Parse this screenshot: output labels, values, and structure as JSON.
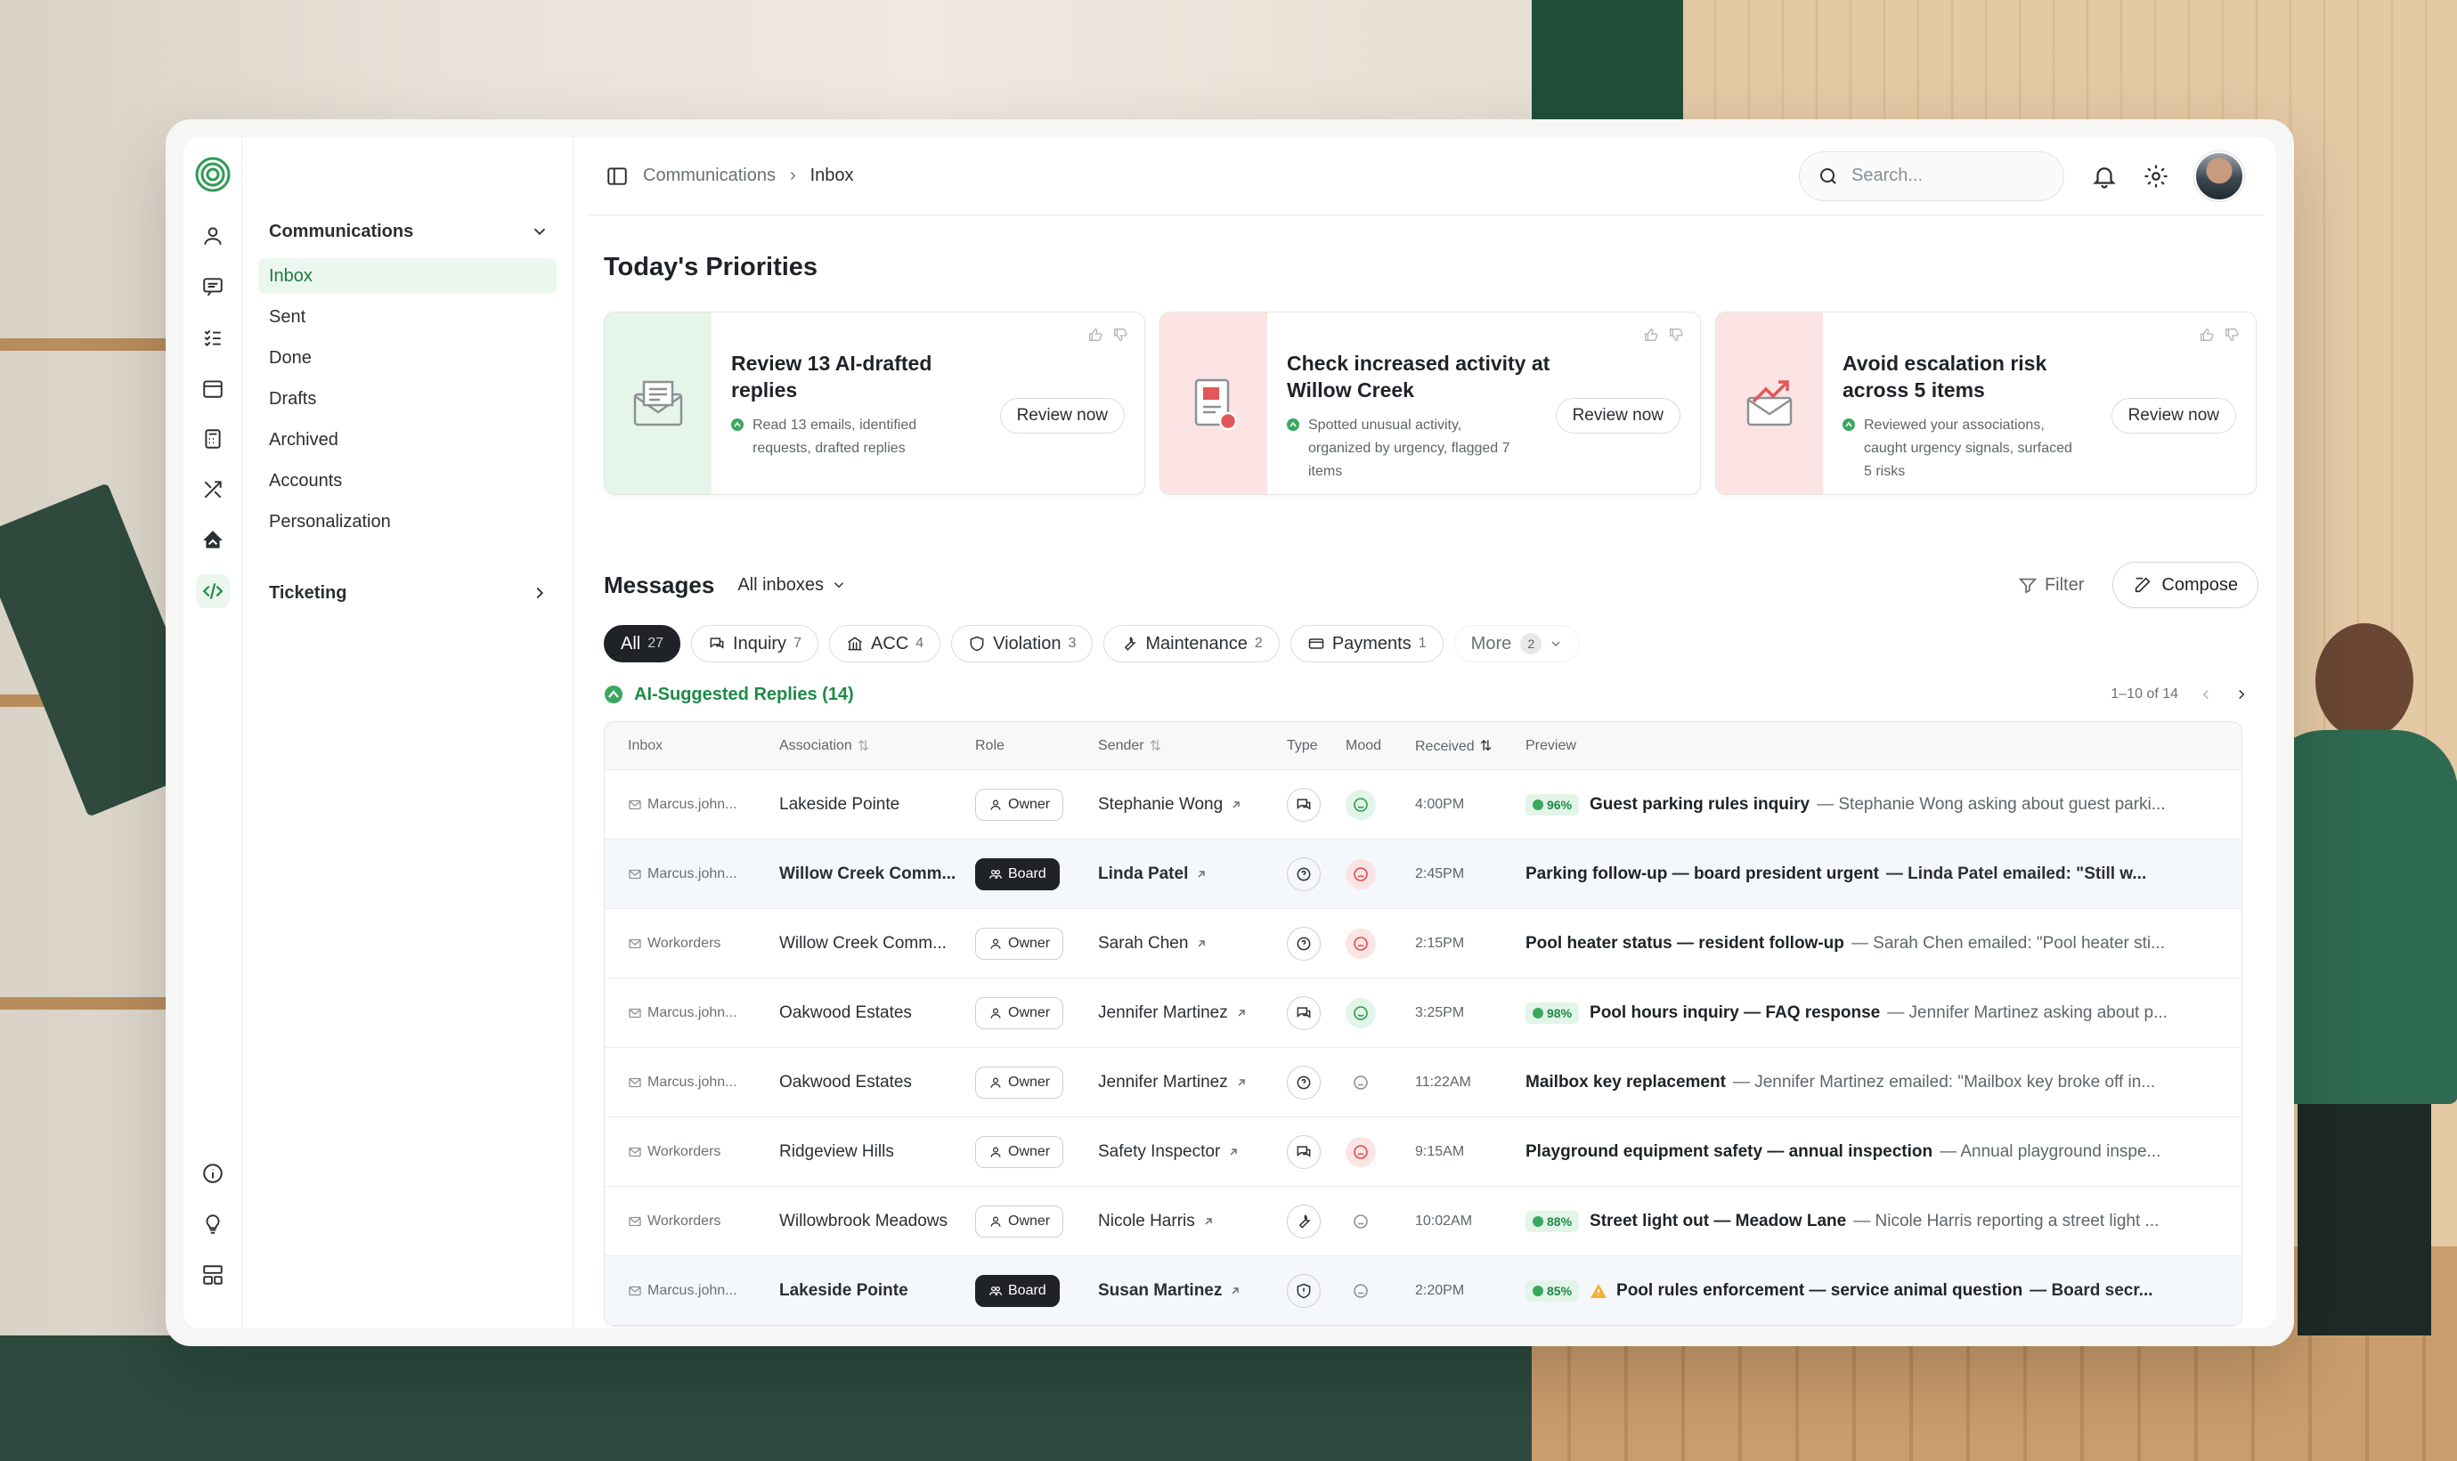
{
  "breadcrumb": {
    "section": "Communications",
    "current": "Inbox"
  },
  "search": {
    "placeholder": "Search..."
  },
  "sidebar": {
    "section1": "Communications",
    "items": [
      "Inbox",
      "Sent",
      "Done",
      "Drafts",
      "Archived",
      "Accounts",
      "Personalization"
    ],
    "section2": "Ticketing"
  },
  "priorities": {
    "title": "Today's Priorities",
    "cards": [
      {
        "title": "Review 13 AI-drafted replies",
        "desc": "Read 13 emails, identified requests, drafted replies",
        "button": "Review now"
      },
      {
        "title": "Check increased activity at Willow Creek",
        "desc": "Spotted unusual activity, organized by urgency, flagged 7 items",
        "button": "Review now"
      },
      {
        "title": "Avoid escalation risk across 5 items",
        "desc": "Reviewed your associations, caught urgency signals, surfaced 5 risks",
        "button": "Review now"
      }
    ]
  },
  "messages": {
    "title": "Messages",
    "inbox_selector": "All inboxes",
    "filter": "Filter",
    "compose": "Compose",
    "chips": [
      {
        "label": "All",
        "count": "27"
      },
      {
        "label": "Inquiry",
        "count": "7"
      },
      {
        "label": "ACC",
        "count": "4"
      },
      {
        "label": "Violation",
        "count": "3"
      },
      {
        "label": "Maintenance",
        "count": "2"
      },
      {
        "label": "Payments",
        "count": "1"
      },
      {
        "label": "More",
        "count": "2"
      }
    ],
    "ai_suggested": "AI-Suggested Replies (14)",
    "pager": "1–10 of 14",
    "columns": {
      "inbox": "Inbox",
      "association": "Association",
      "role": "Role",
      "sender": "Sender",
      "type": "Type",
      "mood": "Mood",
      "received": "Received",
      "preview": "Preview"
    },
    "rows": [
      {
        "inbox": "Marcus.john...",
        "association": "Lakeside Pointe",
        "role": "Owner",
        "sender": "Stephanie Wong",
        "received": "4:00PM",
        "pct": "96%",
        "subject": "Guest parking rules inquiry",
        "snippet": "— Stephanie Wong asking about guest parki..."
      },
      {
        "inbox": "Marcus.john...",
        "association": "Willow Creek Comm...",
        "role": "Board",
        "sender": "Linda Patel",
        "received": "2:45PM",
        "pct": "",
        "subject": "Parking follow-up — board president urgent",
        "snippet": "— Linda Patel emailed: \"Still w..."
      },
      {
        "inbox": "Workorders",
        "association": "Willow Creek Comm...",
        "role": "Owner",
        "sender": "Sarah Chen",
        "received": "2:15PM",
        "pct": "",
        "subject": "Pool heater status — resident follow-up",
        "snippet": "— Sarah Chen emailed: \"Pool heater sti..."
      },
      {
        "inbox": "Marcus.john...",
        "association": "Oakwood Estates",
        "role": "Owner",
        "sender": "Jennifer Martinez",
        "received": "3:25PM",
        "pct": "98%",
        "subject": "Pool hours inquiry — FAQ response",
        "snippet": "— Jennifer Martinez asking about p..."
      },
      {
        "inbox": "Marcus.john...",
        "association": "Oakwood Estates",
        "role": "Owner",
        "sender": "Jennifer Martinez",
        "received": "11:22AM",
        "pct": "",
        "subject": "Mailbox key replacement",
        "snippet": "— Jennifer Martinez emailed: \"Mailbox key broke off in..."
      },
      {
        "inbox": "Workorders",
        "association": "Ridgeview Hills",
        "role": "Owner",
        "sender": "Safety Inspector",
        "received": "9:15AM",
        "pct": "",
        "subject": "Playground equipment safety — annual inspection",
        "snippet": "— Annual playground inspe..."
      },
      {
        "inbox": "Workorders",
        "association": "Willowbrook Meadows",
        "role": "Owner",
        "sender": "Nicole Harris",
        "received": "10:02AM",
        "pct": "88%",
        "subject": "Street light out — Meadow Lane",
        "snippet": "— Nicole Harris reporting a street light ..."
      },
      {
        "inbox": "Marcus.john...",
        "association": "Lakeside Pointe",
        "role": "Board",
        "sender": "Susan Martinez",
        "received": "2:20PM",
        "pct": "85%",
        "subject": "Pool rules enforcement — service animal question",
        "snippet": "— Board secr..."
      }
    ]
  },
  "colors": {
    "accent_green": "#1e8a46",
    "danger": "#d94c4c",
    "dark": "#1f2328"
  }
}
